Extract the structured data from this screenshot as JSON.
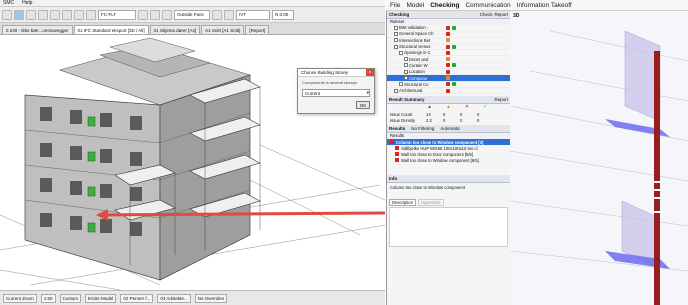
{
  "app": {
    "menu": [
      "SMC",
      "Help"
    ]
  },
  "toolbar": {
    "name_field": "FC-FLT",
    "outside_face_label": "Outside Face",
    "value_field": "IVT",
    "dimension_field": "N 0.00"
  },
  "tabs": [
    "01 IFC Standard eksport [3D / All]",
    "01 Skjema dører [A4]",
    "A1 Snitt [A1 Snitt]",
    "[Report]"
  ],
  "tab_prefix": "0 240 - Ikke bær...ommavegger",
  "dialog": {
    "title": "Choose Building Storey",
    "hint": "Components in several storeys",
    "selected": "Current",
    "ok_label": "OK"
  },
  "statusbar": {
    "zoom": "Current Zoom",
    "scale": "1:50",
    "custom": "Custom",
    "model": "Entire Model",
    "pen_set": "02 Penner f...",
    "arch": "03 Arkitekte...",
    "overrides": "No Overrides"
  },
  "topmenu": {
    "items": [
      "File",
      "Model",
      "Checking",
      "Communication",
      "Information Takeoff"
    ],
    "active": "Checking"
  },
  "checking": {
    "title": "Checking",
    "check_label": "Check",
    "report_label": "Report",
    "ruleset_header": "Ruleset",
    "rows": [
      {
        "label": "BIM Validation -",
        "indent": 1
      },
      {
        "label": "General Space Ch",
        "indent": 1
      },
      {
        "label": "Intersections Bet",
        "indent": 1
      },
      {
        "label": "Structural versus",
        "indent": 1
      },
      {
        "label": "Openings in C",
        "indent": 2
      },
      {
        "label": "Doors and",
        "indent": 3
      },
      {
        "label": "Curtain W",
        "indent": 3
      },
      {
        "label": "Location",
        "indent": 3
      },
      {
        "label": "Compone",
        "indent": 3,
        "selected": true
      },
      {
        "label": "Structural Co",
        "indent": 2
      },
      {
        "label": "Architectural",
        "indent": 1
      }
    ]
  },
  "result_summary": {
    "title": "Result Summary",
    "report_label": "Report",
    "rows": [
      {
        "label": "Issue Count",
        "values": [
          "14",
          "0",
          "0",
          "0"
        ]
      },
      {
        "label": "Issue Density",
        "values": [
          "2.2",
          "0",
          "0",
          "0"
        ]
      }
    ]
  },
  "results": {
    "title": "Results",
    "filter_label": "No Filtering",
    "auto_label": "Automatic",
    "header": "Results",
    "items": [
      {
        "text": "Column too close to Window component [3]",
        "selected": true
      },
      {
        "text": "Stålbjelke HUP 80X55 100x100x10 too cl",
        "selected": false
      },
      {
        "text": "Wall too close to Door component [6/5]",
        "selected": false
      },
      {
        "text": "Wall too close to Window component [6/5]",
        "selected": false
      }
    ]
  },
  "info": {
    "title": "Info",
    "text": "Column too close to Window component",
    "tabs": [
      "Description",
      "Hyperlinks"
    ]
  },
  "view3d": {
    "label": "3D"
  },
  "colors": {
    "accent": "#2d6fd6",
    "arrow": "#e04a3f",
    "column": "#9a1d1d",
    "highlight": "#6a6cf0"
  }
}
